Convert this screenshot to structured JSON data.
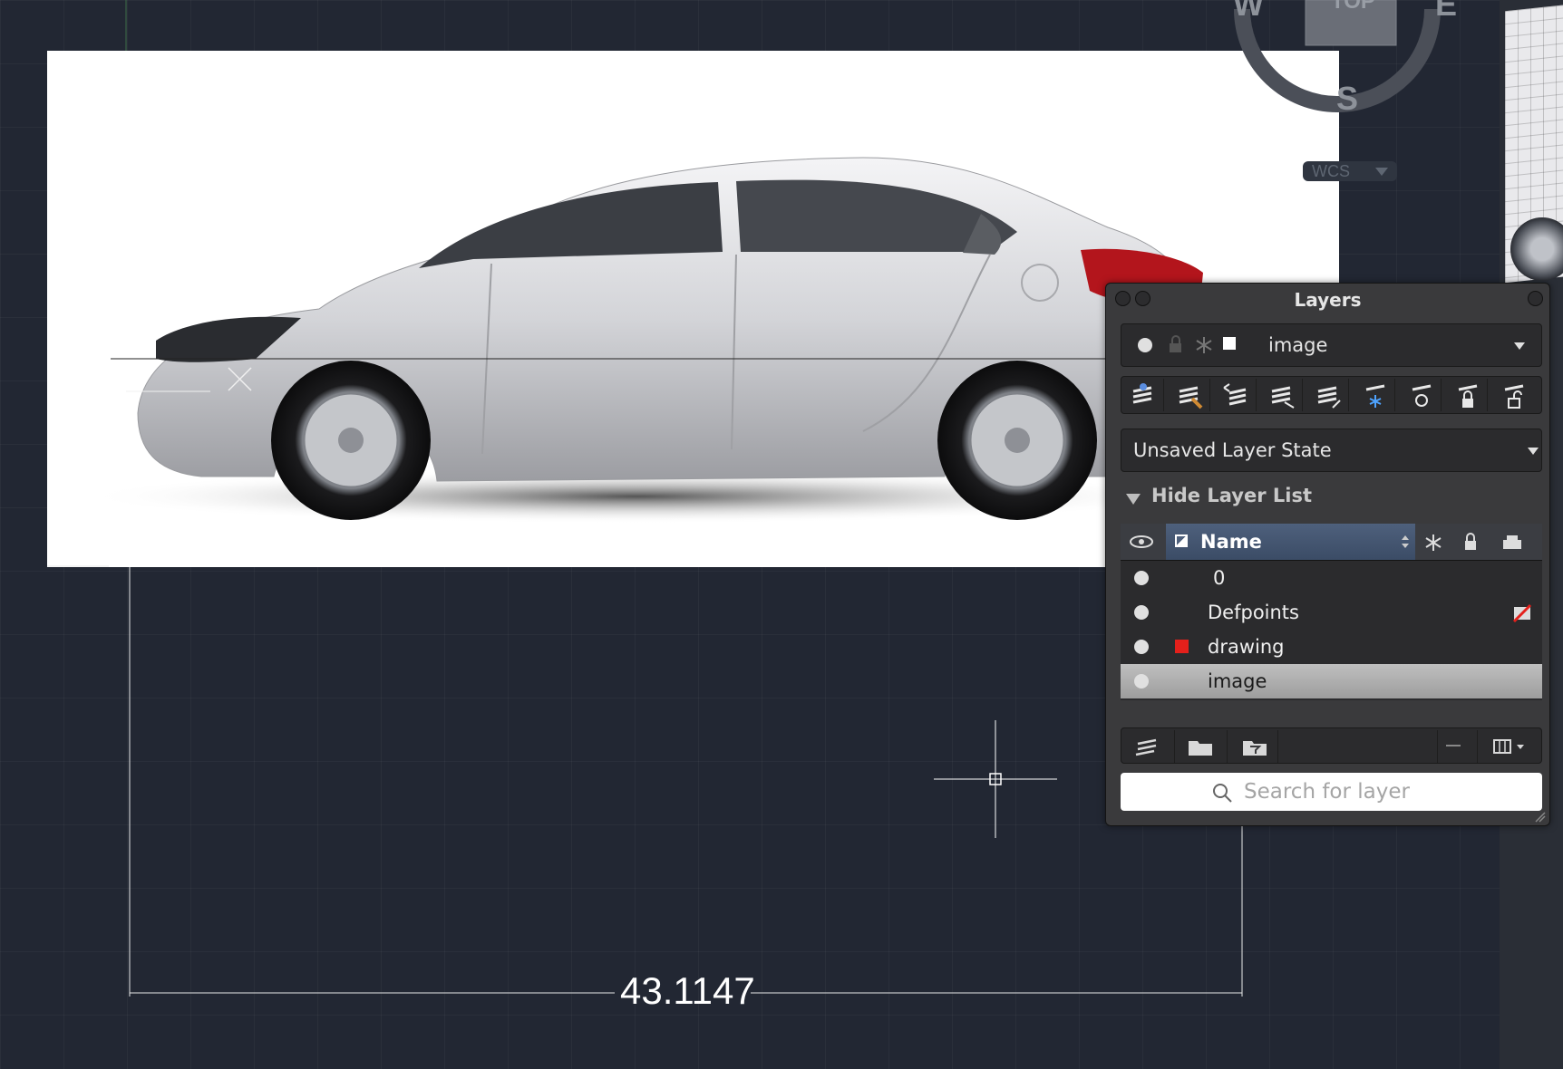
{
  "viewcube": {
    "west": "W",
    "top": "TOP",
    "east": "E",
    "south": "S",
    "wcs": "WCS"
  },
  "dimension": {
    "value": "43.1147"
  },
  "layers_panel": {
    "title": "Layers",
    "current_layer": "image",
    "layer_state": "Unsaved Layer State",
    "hide_list_label": "Hide Layer List",
    "column_name": "Name",
    "layers": [
      {
        "name": "0",
        "color": "none",
        "selected": false
      },
      {
        "name": "Defpoints",
        "color": "none",
        "selected": false
      },
      {
        "name": "drawing",
        "color": "#e4201b",
        "selected": false
      },
      {
        "name": "image",
        "color": "none",
        "selected": true
      }
    ],
    "search_placeholder": "Search for layer"
  }
}
